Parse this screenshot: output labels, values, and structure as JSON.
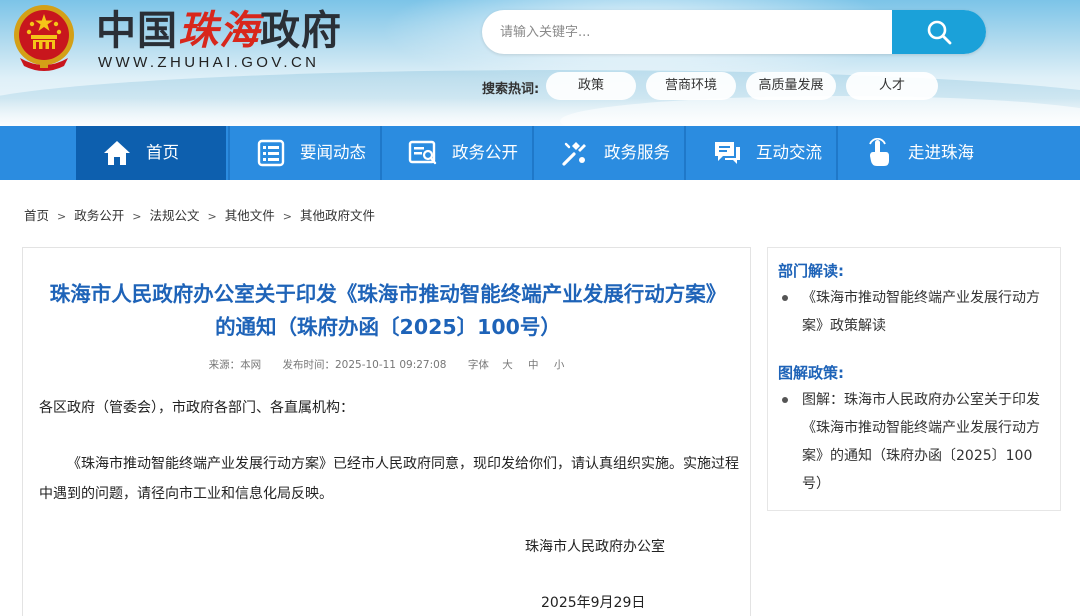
{
  "header": {
    "title_prefix": "中国",
    "title_accent": "珠海",
    "title_suffix": "政府",
    "url": "WWW.ZHUHAI.GOV.CN",
    "search": {
      "placeholder": "请输入关键字..."
    },
    "hot_label": "搜索热词:",
    "hot_tags": [
      "政策",
      "营商环境",
      "高质量发展",
      "人才"
    ]
  },
  "nav": {
    "items": [
      {
        "label": "首页",
        "icon": "home-icon"
      },
      {
        "label": "要闻动态",
        "icon": "news-list-icon"
      },
      {
        "label": "政务公开",
        "icon": "document-search-icon"
      },
      {
        "label": "政务服务",
        "icon": "service-tools-icon"
      },
      {
        "label": "互动交流",
        "icon": "chat-bubble-icon"
      },
      {
        "label": "走进珠海",
        "icon": "pointer-hand-icon"
      }
    ],
    "active_index": 0
  },
  "breadcrumb": [
    "首页",
    "政务公开",
    "法规公文",
    "其他文件",
    "其他政府文件"
  ],
  "article": {
    "title": "珠海市人民政府办公室关于印发《珠海市推动智能终端产业发展行动方案》的通知（珠府办函〔2025〕100号）",
    "meta": {
      "source": "来源：本网",
      "published": "发布时间：2025-10-11 09:27:08",
      "font_label": "字体",
      "font_large": "大",
      "font_medium": "中",
      "font_small": "小"
    },
    "salutation": "各区政府（管委会），市政府各部门、各直属机构：",
    "body": "《珠海市推动智能终端产业发展行动方案》已经市人民政府同意，现印发给你们，请认真组织实施。实施过程中遇到的问题，请径向市工业和信息化局反映。",
    "signer": "珠海市人民政府办公室",
    "date": "2025年9月29日"
  },
  "sidebar": {
    "sections": [
      {
        "heading": "部门解读:",
        "items": [
          "《珠海市推动智能终端产业发展行动方案》政策解读"
        ]
      },
      {
        "heading": "图解政策:",
        "items": [
          "图解：珠海市人民政府办公室关于印发《珠海市推动智能终端产业发展行动方案》的通知（珠府办函〔2025〕100号）"
        ]
      }
    ]
  },
  "colors": {
    "nav_bg": "#2b8ce0",
    "nav_active": "#0d5fae",
    "search_button": "#1ba1d9",
    "title_blue": "#1e63b8",
    "accent_red": "#d8271c"
  }
}
